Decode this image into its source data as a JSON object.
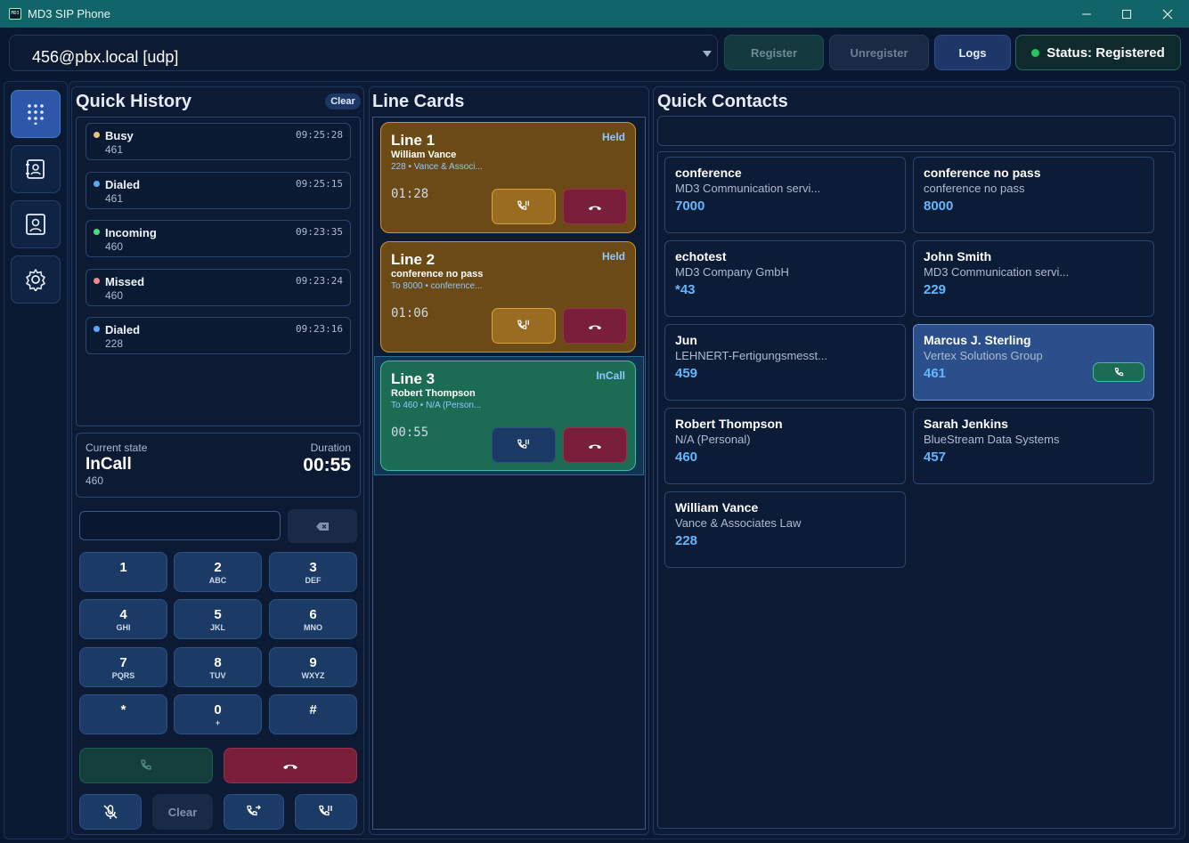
{
  "window": {
    "title": "MD3 SIP Phone",
    "logo": "MD3"
  },
  "toolbar": {
    "account": "456@pbx.local [udp]",
    "register_label": "Register",
    "unregister_label": "Unregister",
    "logs_label": "Logs",
    "status_label": "Status: Registered"
  },
  "history": {
    "title": "Quick History",
    "clear_label": "Clear",
    "items": [
      {
        "label": "Busy",
        "number": "461",
        "time": "09:25:28",
        "color": "#e8c27a"
      },
      {
        "label": "Dialed",
        "number": "461",
        "time": "09:25:15",
        "color": "#5aa9ff"
      },
      {
        "label": "Incoming",
        "number": "460",
        "time": "09:23:35",
        "color": "#4ade80"
      },
      {
        "label": "Missed",
        "number": "460",
        "time": "09:23:24",
        "color": "#f2878d"
      },
      {
        "label": "Dialed",
        "number": "228",
        "time": "09:23:16",
        "color": "#5aa9ff"
      }
    ]
  },
  "state": {
    "current_label": "Current state",
    "current_value": "InCall",
    "number": "460",
    "duration_label": "Duration",
    "duration_value": "00:55"
  },
  "dialpad": {
    "keys": [
      {
        "digit": "1",
        "letters": ""
      },
      {
        "digit": "2",
        "letters": "ABC"
      },
      {
        "digit": "3",
        "letters": "DEF"
      },
      {
        "digit": "4",
        "letters": "GHI"
      },
      {
        "digit": "5",
        "letters": "JKL"
      },
      {
        "digit": "6",
        "letters": "MNO"
      },
      {
        "digit": "7",
        "letters": "PQRS"
      },
      {
        "digit": "8",
        "letters": "TUV"
      },
      {
        "digit": "9",
        "letters": "WXYZ"
      },
      {
        "digit": "*",
        "letters": ""
      },
      {
        "digit": "0",
        "letters": "+"
      },
      {
        "digit": "#",
        "letters": ""
      }
    ],
    "clear_label": "Clear"
  },
  "lines": {
    "title": "Line Cards",
    "cards": [
      {
        "title": "Line 1",
        "state": "Held",
        "name": "William Vance",
        "sub": "228 • Vance & Associ...",
        "time": "01:28"
      },
      {
        "title": "Line 2",
        "state": "Held",
        "name": "conference no pass",
        "sub": "To 8000 • conference...",
        "time": "01:06"
      },
      {
        "title": "Line 3",
        "state": "InCall",
        "name": "Robert Thompson",
        "sub": "To 460 • N/A (Person...",
        "time": "00:55"
      }
    ]
  },
  "contacts": {
    "title": "Quick Contacts",
    "search_value": "",
    "items": [
      {
        "name": "conference",
        "org": "MD3 Communication servi...",
        "number": "7000"
      },
      {
        "name": "conference no pass",
        "org": "conference no pass",
        "number": "8000"
      },
      {
        "name": "echotest",
        "org": "MD3 Company GmbH",
        "number": "*43"
      },
      {
        "name": "John Smith",
        "org": "MD3 Communication servi...",
        "number": "229"
      },
      {
        "name": "Jun",
        "org": "LEHNERT-Fertigungsmesst...",
        "number": "459"
      },
      {
        "name": "Marcus J. Sterling",
        "org": "Vertex Solutions Group",
        "number": "461",
        "selected": true
      },
      {
        "name": "Robert Thompson",
        "org": "N/A (Personal)",
        "number": "460"
      },
      {
        "name": "Sarah Jenkins",
        "org": "BlueStream Data Systems",
        "number": "457"
      },
      {
        "name": "William Vance",
        "org": "Vance & Associates Law",
        "number": "228"
      }
    ]
  },
  "colors": {
    "accent": "#2d57a8",
    "held": "#6b4a16",
    "incall": "#1c6b53",
    "hangup": "#7a1f3a",
    "registered": "#22c55e"
  }
}
